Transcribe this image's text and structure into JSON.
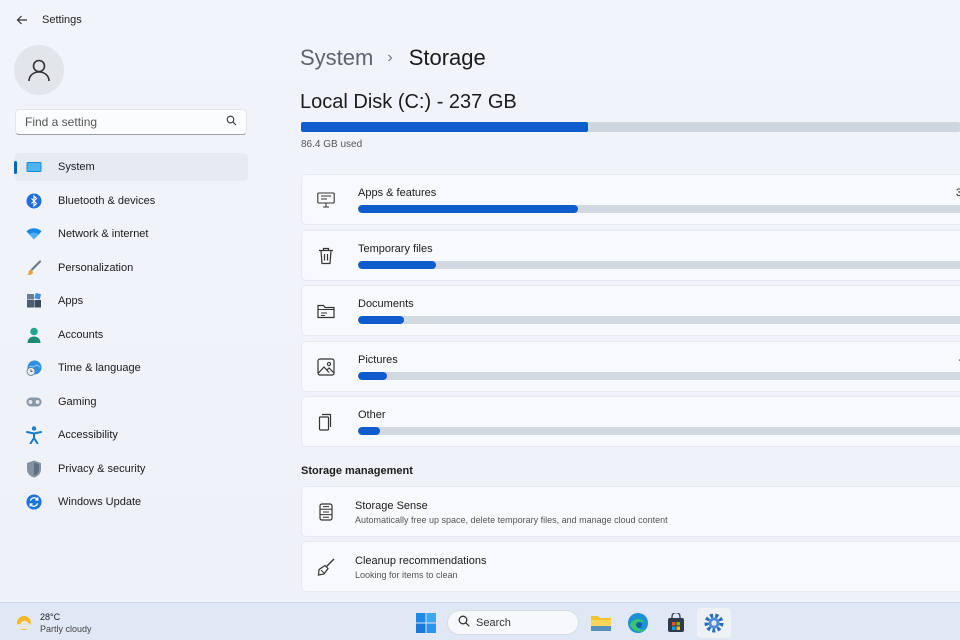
{
  "window": {
    "title": "Settings"
  },
  "sidebar": {
    "search_placeholder": "Find a setting",
    "items": [
      {
        "label": "System",
        "icon": "system-icon",
        "active": true
      },
      {
        "label": "Bluetooth & devices",
        "icon": "bluetooth-icon"
      },
      {
        "label": "Network & internet",
        "icon": "wifi-icon"
      },
      {
        "label": "Personalization",
        "icon": "brush-icon"
      },
      {
        "label": "Apps",
        "icon": "apps-icon"
      },
      {
        "label": "Accounts",
        "icon": "person-icon"
      },
      {
        "label": "Time & language",
        "icon": "globe-clock-icon"
      },
      {
        "label": "Gaming",
        "icon": "gamepad-icon"
      },
      {
        "label": "Accessibility",
        "icon": "accessibility-icon"
      },
      {
        "label": "Privacy & security",
        "icon": "shield-icon"
      },
      {
        "label": "Windows Update",
        "icon": "update-icon"
      }
    ]
  },
  "main": {
    "breadcrumb": {
      "parent": "System",
      "separator": "›",
      "current": "Storage"
    },
    "disk": {
      "title": "Local Disk (C:) - 237 GB",
      "used_label": "86.4 GB used",
      "used_fraction": 0.435
    },
    "categories": [
      {
        "name": "Apps & features",
        "size": "3",
        "fraction": 0.365,
        "icon": "monitor-icon"
      },
      {
        "name": "Temporary files",
        "size": "",
        "fraction": 0.13,
        "icon": "trash-icon"
      },
      {
        "name": "Documents",
        "size": "",
        "fraction": 0.077,
        "icon": "folder-icon"
      },
      {
        "name": "Pictures",
        "size": "-",
        "fraction": 0.048,
        "icon": "image-icon"
      },
      {
        "name": "Other",
        "size": "",
        "fraction": 0.036,
        "icon": "file-copy-icon"
      }
    ],
    "management": {
      "title": "Storage management",
      "items": [
        {
          "title": "Storage Sense",
          "desc": "Automatically free up space, delete temporary files, and manage cloud content",
          "icon": "storage-sense-icon"
        },
        {
          "title": "Cleanup recommendations",
          "desc": "Looking for items to clean",
          "icon": "broom-icon"
        }
      ]
    }
  },
  "taskbar": {
    "weather": {
      "temp": "28°C",
      "condition": "Partly cloudy"
    },
    "search_label": "Search"
  },
  "colors": {
    "accent": "#0f5ccc",
    "track": "#d3d9e2"
  }
}
